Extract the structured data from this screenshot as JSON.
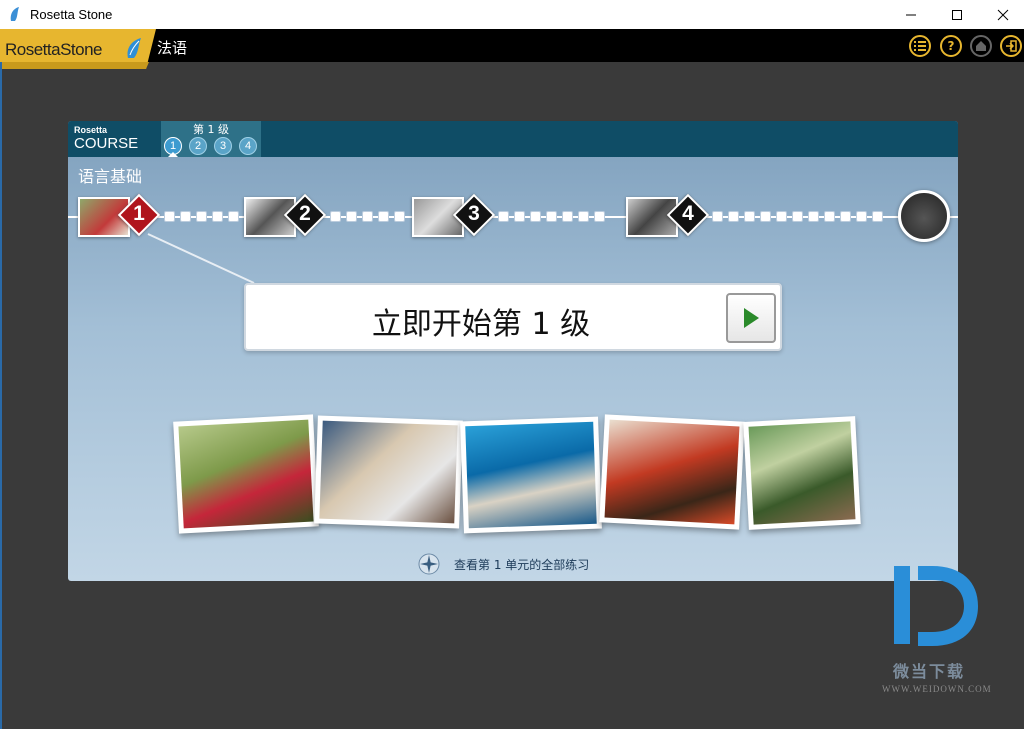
{
  "window": {
    "title": "Rosetta Stone"
  },
  "toolbar": {
    "logo": "RosettaStone",
    "language": "法语",
    "icons": [
      "menu-icon",
      "help-icon",
      "home-icon",
      "exit-icon"
    ],
    "icon_color": "#e7b62f"
  },
  "course": {
    "logo_small": "Rosetta",
    "logo_big": "COURSE",
    "level_title": "第 1 级",
    "levels": [
      "1",
      "2",
      "3",
      "4"
    ],
    "active_level": "1",
    "section_title": "语言基础",
    "units": [
      {
        "number": "1",
        "color": "#b0141c"
      },
      {
        "number": "2",
        "color": "#111111"
      },
      {
        "number": "3",
        "color": "#111111"
      },
      {
        "number": "4",
        "color": "#111111"
      }
    ],
    "start_label": "立即开始第 1 级",
    "review_link": "查看第 1 单元的全部练习"
  },
  "watermark": {
    "text": "微当下载",
    "url": "WWW.WEIDOWN.COM"
  }
}
